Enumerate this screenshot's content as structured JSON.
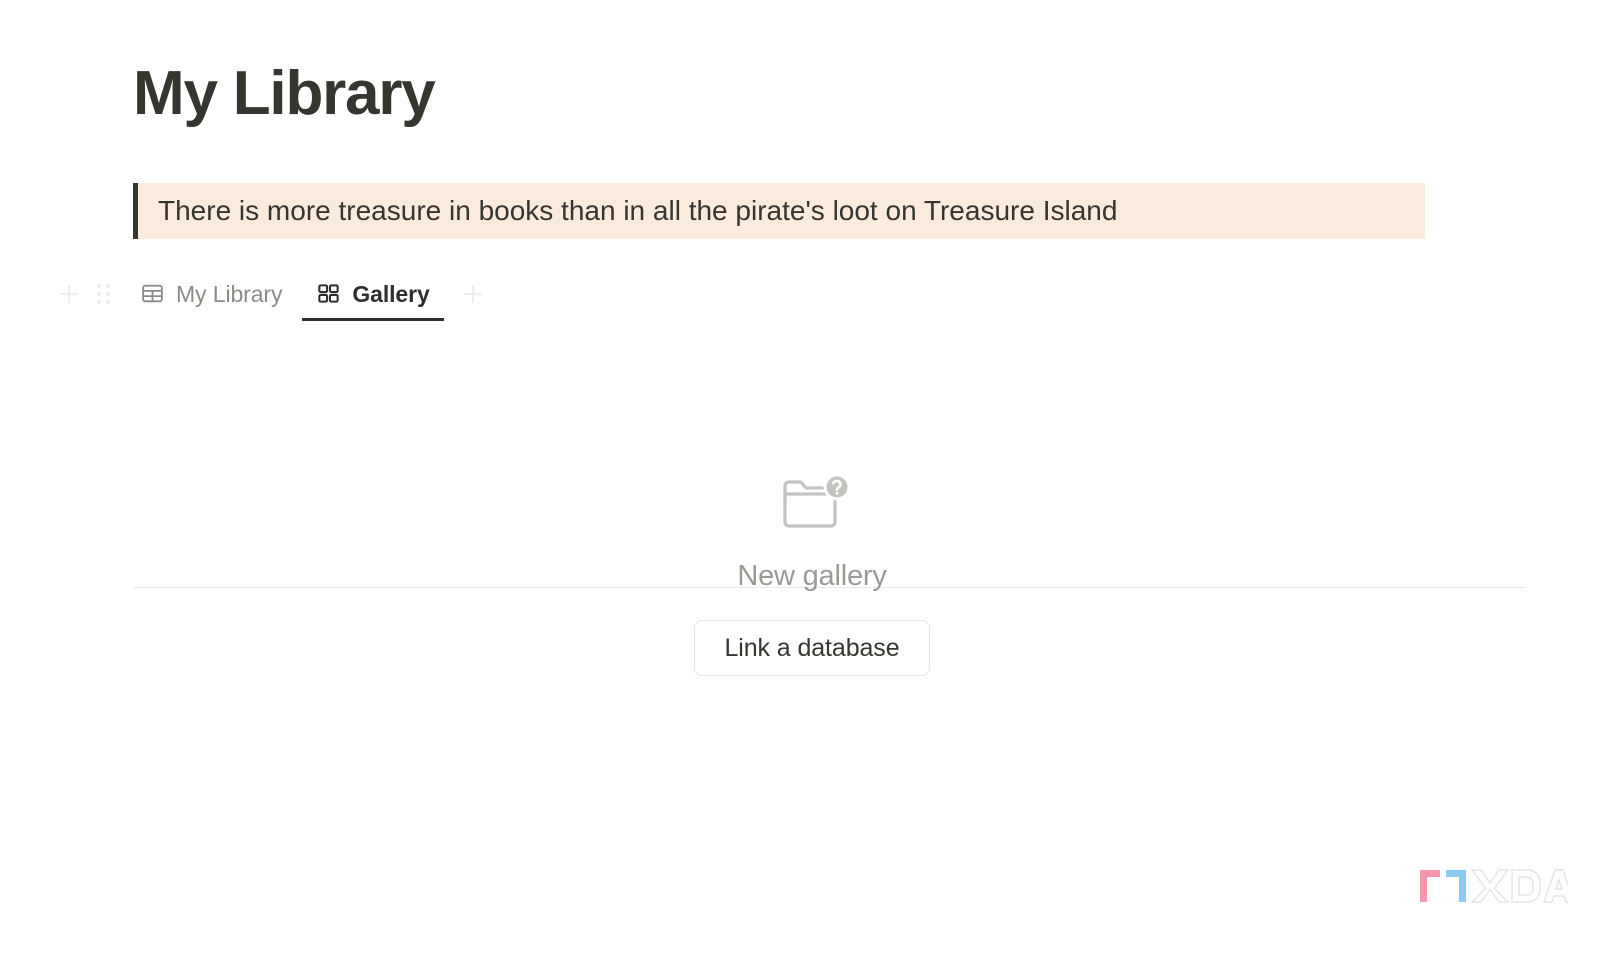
{
  "page": {
    "title": "My Library",
    "quote": "There is more treasure in books than in all the pirate's loot on Treasure Island"
  },
  "tabbar": {
    "add_view_left_icon": "plus-icon",
    "drag_handle_icon": "drag-handle-icon",
    "add_view_right_icon": "plus-icon",
    "tabs": [
      {
        "label": "My Library",
        "icon": "table-icon",
        "active": false
      },
      {
        "label": "Gallery",
        "icon": "grid-icon",
        "active": true
      }
    ]
  },
  "empty_state": {
    "icon": "folder-question-icon",
    "title": "New gallery",
    "button_label": "Link a database"
  },
  "watermark": {
    "label": "XDA"
  },
  "colors": {
    "text_primary": "#37352f",
    "text_muted": "#8c8b87",
    "text_placeholder": "#9b9a96",
    "quote_background": "#faebdd",
    "quote_bar": "#37352f",
    "divider": "#eceae6",
    "button_border": "#e6e5e2",
    "icon_light": "#eeeeed",
    "empty_icon": "#c4c3c0",
    "page_background": "#ffffff"
  }
}
